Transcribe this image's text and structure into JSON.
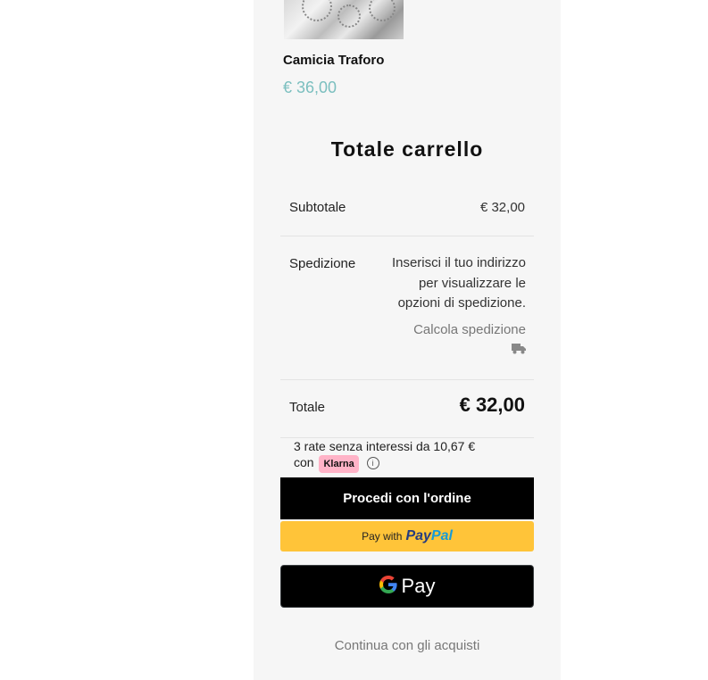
{
  "product": {
    "name": "Camicia Traforo",
    "price": "€ 36,00"
  },
  "cart_totals": {
    "title": "Totale carrello",
    "subtotal_label": "Subtotale",
    "subtotal_value": "€ 32,00",
    "shipping_label": "Spedizione",
    "shipping_info": "Inserisci il tuo indirizzo per visualizzare le opzioni di spedizione.",
    "calc_shipping_label": "Calcola spedizione",
    "total_label": "Totale",
    "total_value": "€ 32,00"
  },
  "klarna": {
    "text_line1": "3 rate senza interessi da 10,67 €",
    "text_prefix": "con",
    "badge": "Klarna",
    "info_icon": "i"
  },
  "buttons": {
    "checkout": "Procedi con l'ordine",
    "paypal_prefix": "Pay with",
    "paypal_pay": "Pay",
    "paypal_pal": "Pal",
    "gpay": "Pay",
    "continue": "Continua con gli acquisti"
  },
  "colors": {
    "price_accent": "#7bbfbf",
    "paypal_yellow": "#ffc439",
    "klarna_pink": "#ffb3c7"
  }
}
